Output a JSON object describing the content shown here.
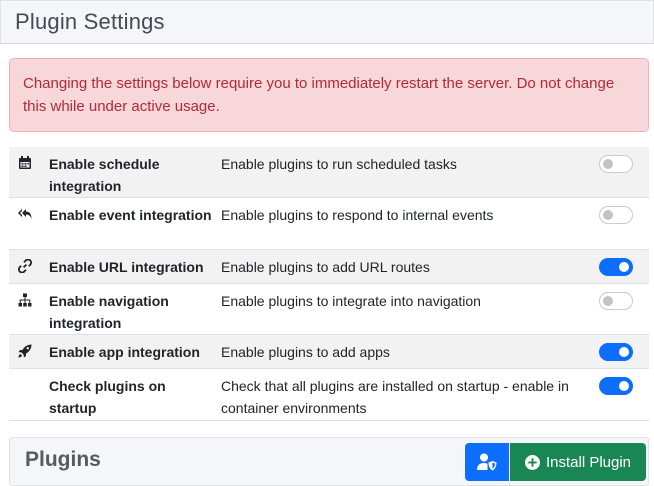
{
  "panel": {
    "title": "Plugin Settings"
  },
  "alert": {
    "text": "Changing the settings below require you to immediately restart the server. Do not change this while under active usage."
  },
  "settings": [
    {
      "icon": "calendar-icon",
      "label": "Enable schedule integration",
      "description": "Enable plugins to run scheduled tasks",
      "enabled": false
    },
    {
      "icon": "reply-all-icon",
      "label": "Enable event integration",
      "description": "Enable plugins to respond to internal events",
      "enabled": false
    },
    {
      "icon": "link-icon",
      "label": "Enable URL integration",
      "description": "Enable plugins to add URL routes",
      "enabled": true
    },
    {
      "icon": "sitemap-icon",
      "label": "Enable navigation integration",
      "description": "Enable plugins to integrate into navigation",
      "enabled": false
    },
    {
      "icon": "rocket-icon",
      "label": "Enable app integration",
      "description": "Enable plugins to add apps",
      "enabled": true
    },
    {
      "icon": "",
      "label": "Check plugins on startup",
      "description": "Check that all plugins are installed on startup - enable in container environments",
      "enabled": true
    }
  ],
  "plugins": {
    "title": "Plugins",
    "permissions_icon": "user-shield-icon",
    "install_icon": "plus-circle-icon",
    "install_label": "Install Plugin"
  },
  "colors": {
    "toggle_on": "#0d6efd",
    "install": "#198754",
    "alert_bg": "#f8d7da",
    "alert_text": "#b02a37"
  }
}
